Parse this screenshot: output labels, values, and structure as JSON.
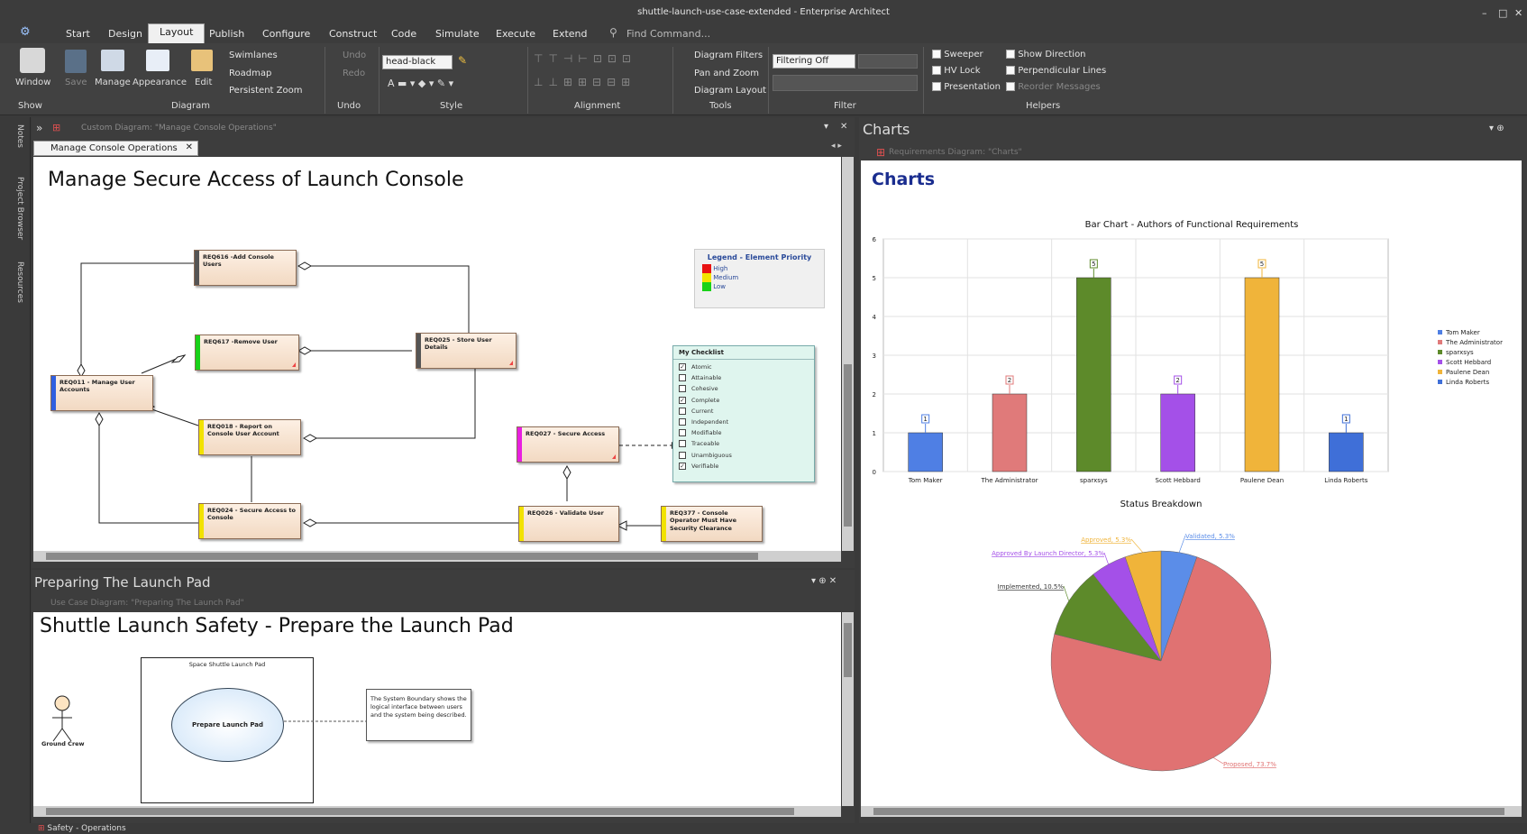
{
  "window": {
    "title": "shuttle-launch-use-case-extended - Enterprise Architect"
  },
  "menu": {
    "items": [
      "Start",
      "Design",
      "Layout",
      "Publish",
      "Configure",
      "Construct",
      "Code",
      "Simulate",
      "Execute",
      "Extend"
    ],
    "active": "Layout",
    "find_command": "Find Command..."
  },
  "ribbon": {
    "window_label": "Window",
    "save_label": "Save",
    "manage_label": "Manage",
    "appearance_label": "Appearance",
    "edit_label": "Edit",
    "swimlanes": "Swimlanes",
    "roadmap": "Roadmap",
    "persistent_zoom": "Persistent Zoom",
    "undo": "Undo",
    "redo": "Redo",
    "style_value": "head-black",
    "diagram_filters": "Diagram Filters",
    "pan_zoom": "Pan and Zoom",
    "diagram_layout": "Diagram Layout",
    "filter_value": "Filtering Off",
    "helpers": [
      "Sweeper",
      "HV Lock",
      "Presentation",
      "Show Direction",
      "Perpendicular Lines",
      "Reorder Messages"
    ],
    "groups": [
      "Show",
      "Diagram",
      "Undo",
      "Style",
      "Alignment",
      "Tools",
      "Filter",
      "Helpers"
    ]
  },
  "left_strip": {
    "notes": "Notes",
    "project_browser": "Project Browser",
    "resources": "Resources"
  },
  "top_diagram": {
    "header_caption": "Custom Diagram: \"Manage Console Operations\"",
    "tab": "Manage Console Operations",
    "title": "Manage Secure Access of Launch Console",
    "elements": [
      {
        "id": "REQ616",
        "text": "REQ616 -Add Console Users"
      },
      {
        "id": "REQ617",
        "text": "REQ617 -Remove User"
      },
      {
        "id": "REQ025",
        "text": "REQ025 - Store User Details"
      },
      {
        "id": "REQ011",
        "text": "REQ011 - Manage User Accounts"
      },
      {
        "id": "REQ018",
        "text": "REQ018 - Report on Console User Account"
      },
      {
        "id": "REQ027",
        "text": "REQ027 - Secure Access"
      },
      {
        "id": "REQ024",
        "text": "REQ024 - Secure Access to Console"
      },
      {
        "id": "REQ026",
        "text": "REQ026 - Validate User"
      },
      {
        "id": "REQ377",
        "text": "REQ377 - Console Operator Must Have Security Clearance"
      }
    ],
    "legend": {
      "title": "Legend - Element Priority",
      "items": [
        {
          "label": "High",
          "color": "#e81212"
        },
        {
          "label": "Medium",
          "color": "#f2e200"
        },
        {
          "label": "Low",
          "color": "#19d219"
        }
      ]
    },
    "checklist": {
      "title": "My Checklist",
      "items": [
        {
          "label": "Atomic",
          "checked": true
        },
        {
          "label": "Attainable",
          "checked": false
        },
        {
          "label": "Cohesive",
          "checked": false
        },
        {
          "label": "Complete",
          "checked": true
        },
        {
          "label": "Current",
          "checked": false
        },
        {
          "label": "Independent",
          "checked": false
        },
        {
          "label": "Modifiable",
          "checked": false
        },
        {
          "label": "Traceable",
          "checked": false
        },
        {
          "label": "Unambiguous",
          "checked": false
        },
        {
          "label": "Verifiable",
          "checked": true
        }
      ]
    }
  },
  "bottom_diagram": {
    "panel_title": "Preparing The Launch Pad",
    "header_caption": "Use Case Diagram: \"Preparing The Launch Pad\"",
    "title": "Shuttle Launch Safety - Prepare the Launch Pad",
    "boundary": "Space Shuttle Launch Pad",
    "usecase": "Prepare Launch Pad",
    "actor": "Ground Crew",
    "note": "The System Boundary shows the logical interface between users and the system being described."
  },
  "charts_panel": {
    "panel_title": "Charts",
    "header_caption": "Requirements Diagram: \"Charts\"",
    "title": "Charts"
  },
  "status_bar": {
    "text": "Safety - Operations"
  },
  "chart_data": [
    {
      "type": "bar",
      "title": "Bar Chart - Authors of Functional Requirements",
      "categories": [
        "Tom Maker",
        "The Administrator",
        "sparxsys",
        "Scott Hebbard",
        "Paulene Dean",
        "Linda Roberts"
      ],
      "values": [
        1,
        2,
        5,
        2,
        5,
        1
      ],
      "colors": [
        "#4f7fe4",
        "#e07a7a",
        "#5d8a2a",
        "#a450e8",
        "#f0b43a",
        "#3f6fd8"
      ],
      "ylim": [
        0,
        6
      ],
      "yticks": [
        "0",
        "1",
        "2",
        "3",
        "4",
        "5",
        "6"
      ],
      "legend_position": "right",
      "grid": true
    },
    {
      "type": "pie",
      "title": "Status Breakdown",
      "slices": [
        {
          "label": "Validated, 5.3%",
          "value": 5.3,
          "color": "#5b8de8"
        },
        {
          "label": "Proposed, 73.7%",
          "value": 73.7,
          "color": "#e07272"
        },
        {
          "label": "Implemented, 10.5%",
          "value": 10.5,
          "color": "#5d8a2a"
        },
        {
          "label": "Approved By Launch Director, 5.3%",
          "value": 5.3,
          "color": "#a450e8"
        },
        {
          "label": "Approved, 5.3%",
          "value": 5.3,
          "color": "#f0b43a"
        }
      ]
    }
  ]
}
